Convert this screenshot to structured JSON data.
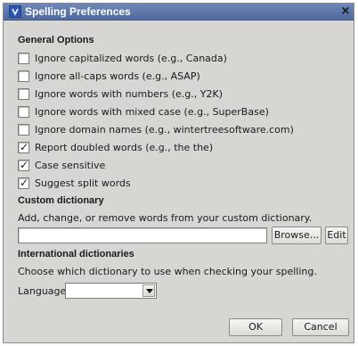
{
  "window": {
    "title": "Spelling Preferences",
    "close_glyph": "×"
  },
  "general": {
    "title": "General Options",
    "options": [
      {
        "label": "Ignore capitalized words (e.g., Canada)",
        "checked": false
      },
      {
        "label": "Ignore all-caps words (e.g., ASAP)",
        "checked": false
      },
      {
        "label": "Ignore words with numbers (e.g., Y2K)",
        "checked": false
      },
      {
        "label": "Ignore words with mixed case (e.g., SuperBase)",
        "checked": false
      },
      {
        "label": "Ignore domain names (e.g., wintertreesoftware.com)",
        "checked": false
      },
      {
        "label": "Report doubled words (e.g., the the)",
        "checked": true
      },
      {
        "label": "Case sensitive",
        "checked": true
      },
      {
        "label": "Suggest split words",
        "checked": true
      }
    ]
  },
  "custom": {
    "title": "Custom dictionary",
    "description": "Add, change, or remove words from your custom dictionary.",
    "path_value": "",
    "browse_label": "Browse...",
    "edit_label": "Edit"
  },
  "international": {
    "title": "International dictionaries",
    "description": "Choose which dictionary to use when checking your spelling.",
    "language_label": "Language",
    "language_value": ""
  },
  "footer": {
    "ok_label": "OK",
    "cancel_label": "Cancel"
  },
  "icons": {
    "app_icon": "spelling-app-icon",
    "close_icon": "close-icon",
    "dropdown_icon": "chevron-down-icon"
  }
}
